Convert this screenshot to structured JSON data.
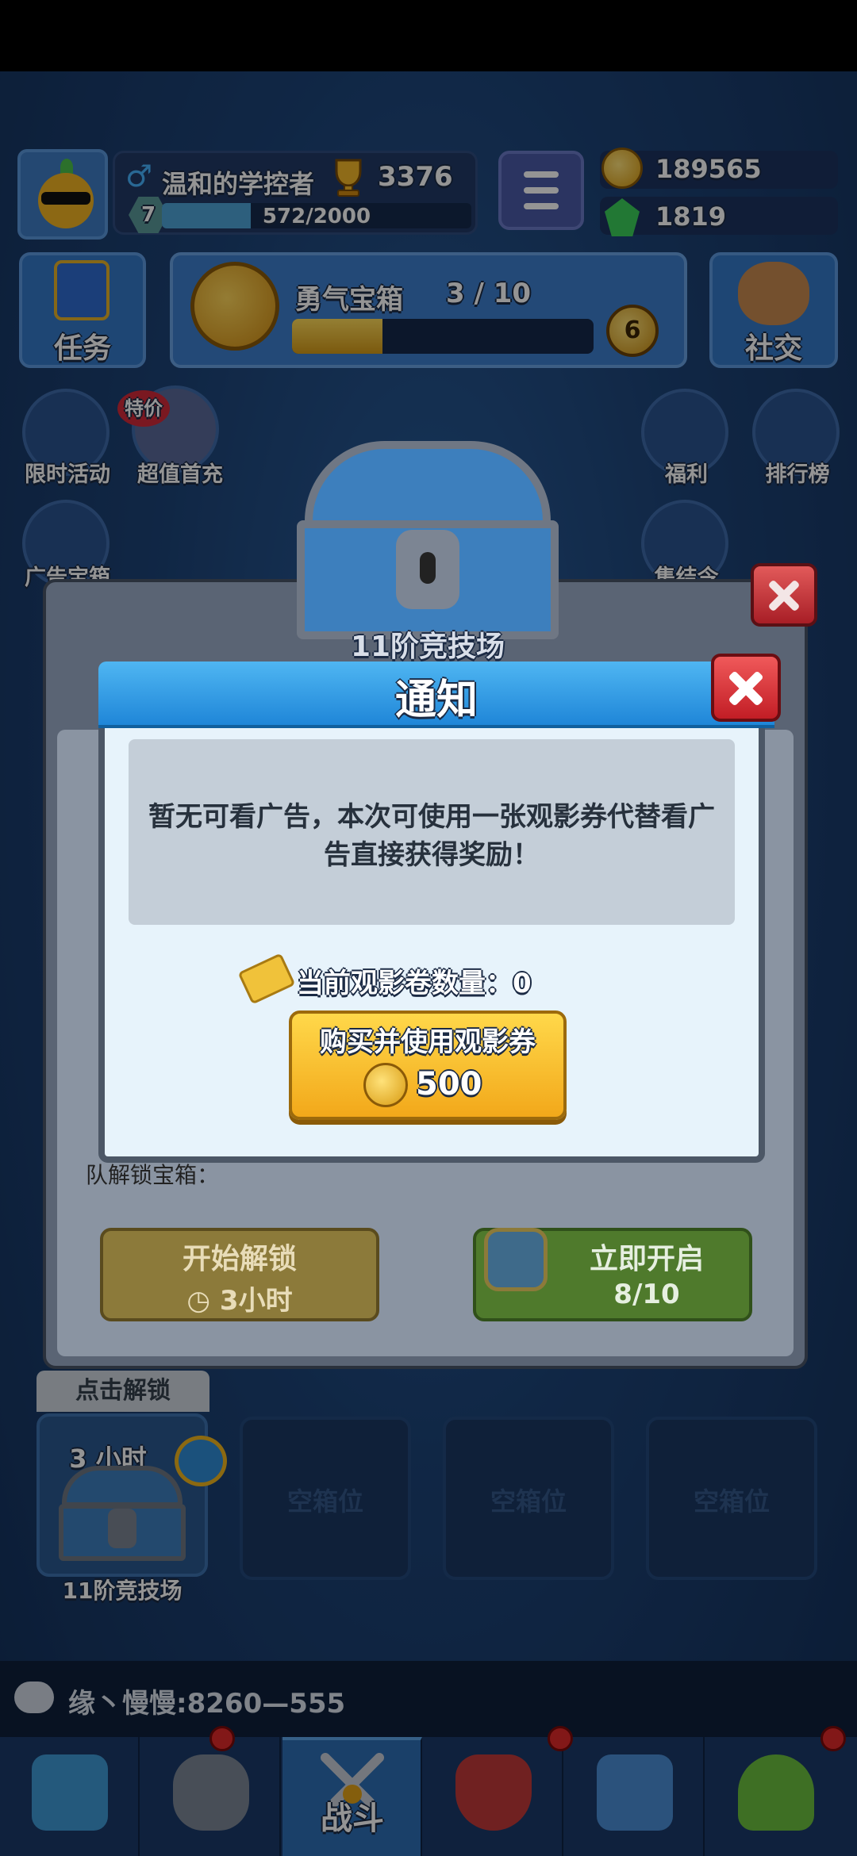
{
  "header": {
    "player_name": "温和的学控者",
    "gender_symbol": "♂",
    "trophies": "3376",
    "level": "7",
    "xp_text": "572/2000",
    "xp_fraction": 0.286,
    "gold": "189565",
    "gems": "1819"
  },
  "row2": {
    "task_label": "任务",
    "chest_progress_title": "勇气宝箱",
    "chest_progress_count": "3 / 10",
    "chest_progress_fraction": 0.3,
    "chest_progress_coin": "6",
    "social_label": "社交"
  },
  "side_icons": {
    "limited": "限时活动",
    "firstpay": "超值首充",
    "firstpay_tag": "特价",
    "welfare": "福利",
    "rank": "排行榜",
    "ad_chest": "广告宝箱",
    "collect": "集结令"
  },
  "chest_dialog": {
    "arena_title": "11阶竞技场",
    "partial_text": "队解锁宝箱：",
    "start_unlock_label": "开始解锁",
    "start_unlock_time": "◷ 3小时",
    "open_now_label": "立即开启",
    "open_now_count": "8/10"
  },
  "notice": {
    "title": "通知",
    "message": "暂无可看广告，本次可使用一张观影券代替看广告直接获得奖励！",
    "ticket_count_text": "当前观影卷数量：0",
    "buy_label": "购买并使用观影券",
    "buy_price": "500"
  },
  "slots": {
    "click_unlock": "点击解锁",
    "slot1_time": "3 小时",
    "slot1_name": "11阶竞技场",
    "empty_label": "空箱位"
  },
  "chat": {
    "text": "缘丶慢慢:8260—555"
  },
  "nav": {
    "battle": "战斗"
  },
  "colors": {
    "accent_blue": "#1f86d8",
    "button_yellow": "#f2a81a",
    "close_red": "#c21d25"
  }
}
